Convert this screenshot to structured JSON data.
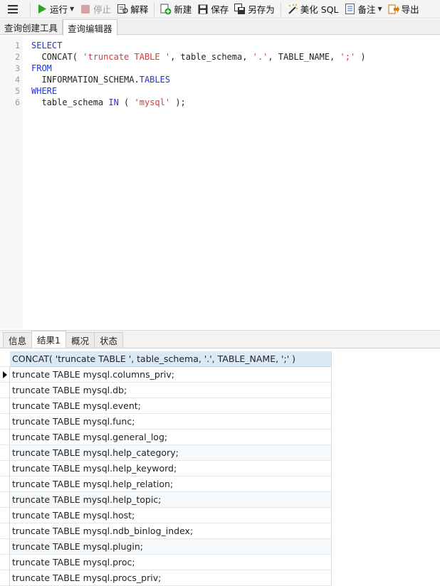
{
  "toolbar": {
    "menu_icon": "menu-icon",
    "run": "运行",
    "stop": "停止",
    "explain": "解释",
    "new": "新建",
    "save": "保存",
    "save_as": "另存为",
    "beautify": "美化 SQL",
    "notes": "备注",
    "export": "导出"
  },
  "top_tabs": [
    "查询创建工具",
    "查询编辑器"
  ],
  "active_top_tab": 1,
  "editor": {
    "line_numbers": [
      "1",
      "2",
      "3",
      "4",
      "5",
      "6"
    ]
  },
  "bottom_tabs": [
    "信息",
    "结果1",
    "概况",
    "状态"
  ],
  "active_bottom_tab": 1,
  "results": {
    "column": "CONCAT( 'truncate TABLE ', table_schema, '.', TABLE_NAME, ';' )",
    "rows": [
      "truncate TABLE mysql.columns_priv;",
      "truncate TABLE mysql.db;",
      "truncate TABLE mysql.event;",
      "truncate TABLE mysql.func;",
      "truncate TABLE mysql.general_log;",
      "truncate TABLE mysql.help_category;",
      "truncate TABLE mysql.help_keyword;",
      "truncate TABLE mysql.help_relation;",
      "truncate TABLE mysql.help_topic;",
      "truncate TABLE mysql.host;",
      "truncate TABLE mysql.ndb_binlog_index;",
      "truncate TABLE mysql.plugin;",
      "truncate TABLE mysql.proc;",
      "truncate TABLE mysql.procs_priv;"
    ]
  },
  "colors": {
    "keyword": "#2233dd",
    "string": "#d43a3a",
    "header_bg": "#dbe9f7",
    "run_green": "#2aa52a"
  }
}
